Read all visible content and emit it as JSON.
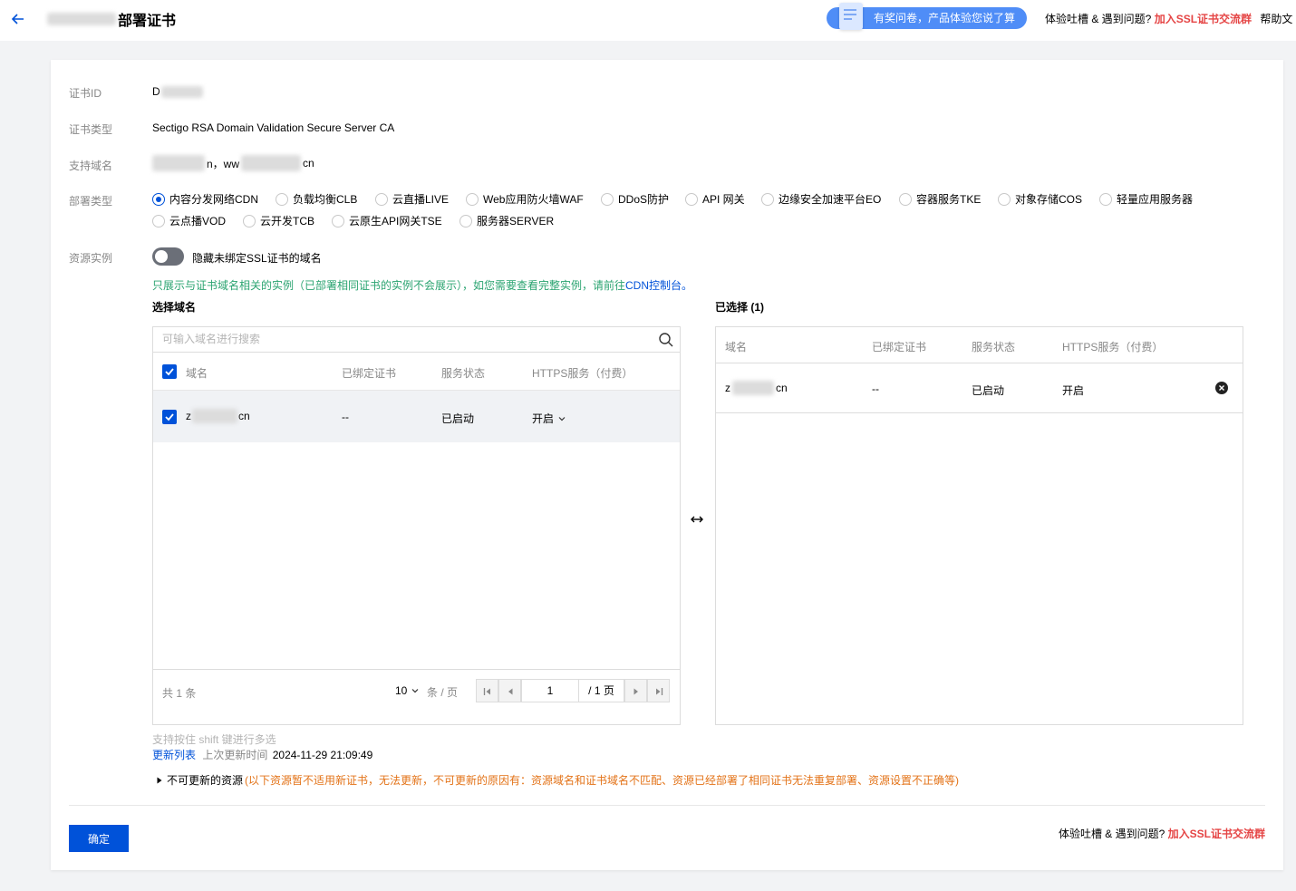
{
  "header": {
    "title": "部署证书",
    "survey": "有奖问卷，产品体验您说了算",
    "feedback_text": "体验吐槽 & 遇到问题?",
    "feedback_link": "加入SSL证书交流群",
    "help": "帮助文"
  },
  "form": {
    "cert_id_label": "证书ID",
    "cert_id_value": "D",
    "cert_type_label": "证书类型",
    "cert_type_value": "Sectigo RSA Domain Validation Secure Server CA",
    "domains_label": "支持域名",
    "domains_part1": "n，ww",
    "domains_part2": "cn",
    "deploy_type_label": "部署类型",
    "deploy_types": [
      {
        "label": "内容分发网络CDN",
        "checked": true
      },
      {
        "label": "负载均衡CLB",
        "checked": false
      },
      {
        "label": "云直播LIVE",
        "checked": false
      },
      {
        "label": "Web应用防火墙WAF",
        "checked": false
      },
      {
        "label": "DDoS防护",
        "checked": false
      },
      {
        "label": "API 网关",
        "checked": false
      },
      {
        "label": "边缘安全加速平台EO",
        "checked": false
      },
      {
        "label": "容器服务TKE",
        "checked": false
      },
      {
        "label": "对象存储COS",
        "checked": false
      },
      {
        "label": "轻量应用服务器",
        "checked": false
      },
      {
        "label": "云点播VOD",
        "checked": false
      },
      {
        "label": "云开发TCB",
        "checked": false
      },
      {
        "label": "云原生API网关TSE",
        "checked": false
      },
      {
        "label": "服务器SERVER",
        "checked": false
      }
    ],
    "resource_label": "资源实例",
    "hide_switch_label": "隐藏未绑定SSL证书的域名",
    "note_prefix": "只展示与证书域名相关的实例（已部署相同证书的实例不会展示），如您需要查看完整实例，请前往",
    "note_link": "CDN控制台。"
  },
  "left_panel": {
    "title": "选择域名",
    "search_placeholder": "可输入域名进行搜索",
    "columns": [
      "域名",
      "已绑定证书",
      "服务状态",
      "HTTPS服务（付费）"
    ],
    "row": {
      "domain_prefix": "z",
      "domain_suffix": "cn",
      "cert": "--",
      "status": "已启动",
      "https": "开启"
    },
    "total": "共 1 条",
    "page_size": "10",
    "per_page": "条 / 页",
    "page_input": "1",
    "page_total": "/ 1 页"
  },
  "right_panel": {
    "title": "已选择 (1)",
    "columns": [
      "域名",
      "已绑定证书",
      "服务状态",
      "HTTPS服务（付费）"
    ],
    "row": {
      "domain_prefix": "z",
      "domain_suffix": "cn",
      "cert": "--",
      "status": "已启动",
      "https": "开启"
    }
  },
  "footer": {
    "shift_hint": "支持按住 shift 键进行多选",
    "refresh_link": "更新列表",
    "last_update_label": "上次更新时间",
    "last_update_time": "2024-11-29 21:09:49",
    "non_update_title": "不可更新的资源",
    "non_update_reason": "(以下资源暂不适用新证书，无法更新，不可更新的原因有：资源域名和证书域名不匹配、资源已经部署了相同证书无法重复部署、资源设置不正确等)",
    "confirm": "确定",
    "feedback_text": "体验吐槽 & 遇到问题?",
    "feedback_link": "加入SSL证书交流群"
  },
  "colors": {
    "primary": "#0052d9",
    "green": "#2ba471",
    "orange": "#e37318",
    "red": "#e54545"
  }
}
